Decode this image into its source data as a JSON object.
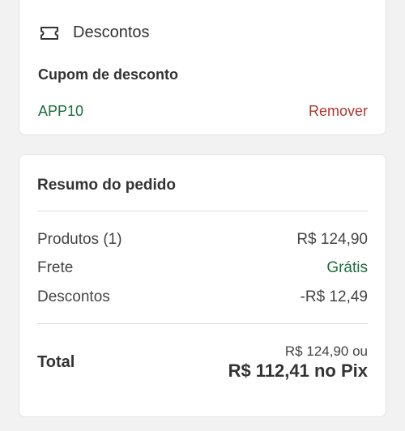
{
  "discounts": {
    "icon": "ticket-icon",
    "title": "Descontos",
    "coupon_label": "Cupom de desconto",
    "coupon_code": "APP10",
    "remove_label": "Remover"
  },
  "summary": {
    "title": "Resumo do pedido",
    "rows": [
      {
        "label": "Produtos (1)",
        "value": "R$ 124,90"
      },
      {
        "label": "Frete",
        "value": "Grátis"
      },
      {
        "label": "Descontos",
        "value": "-R$ 12,49"
      }
    ],
    "total_label": "Total",
    "total_alt": "R$ 124,90 ou",
    "total_pix": "R$ 112,41 no Pix"
  },
  "colors": {
    "green": "#1e6b3c",
    "red": "#a83a32"
  }
}
